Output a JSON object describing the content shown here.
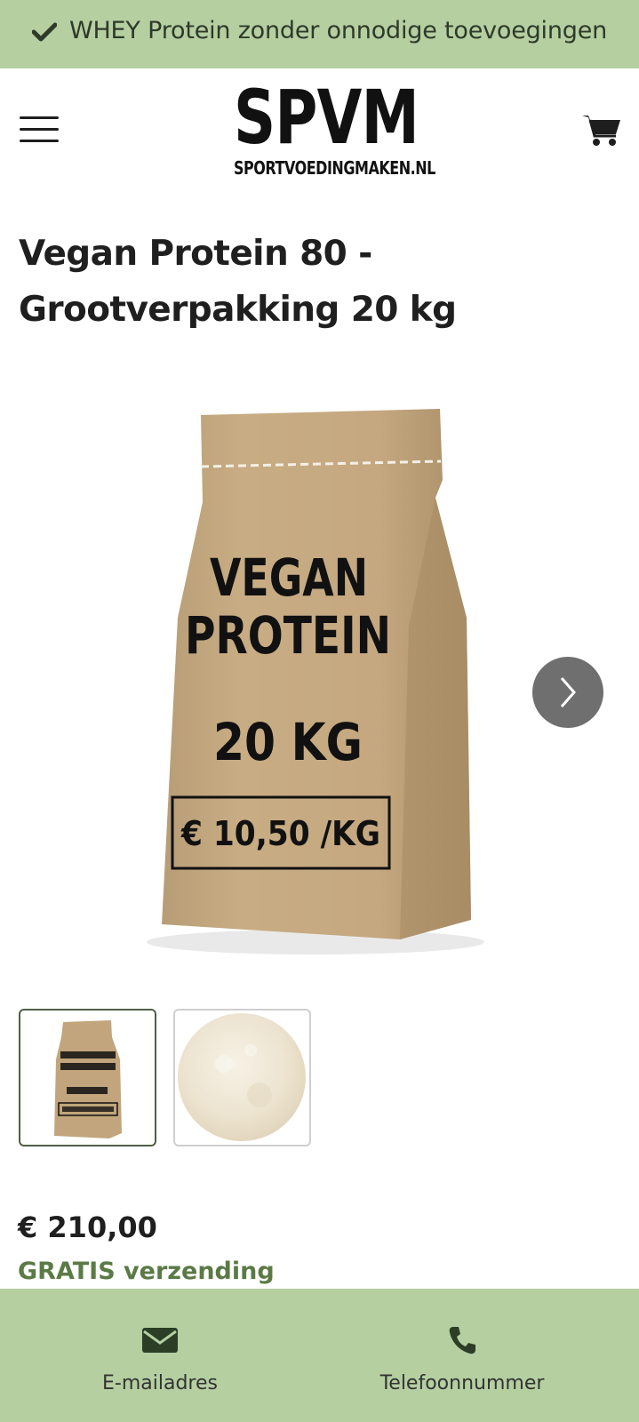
{
  "announcement": {
    "text": "WHEY Protein zonder onnodige toevoegingen"
  },
  "header": {
    "logo_main": "SPVM",
    "logo_sub": "SPORTVOEDINGMAKEN.NL"
  },
  "product": {
    "title_line1": "Vegan Protein 80 -",
    "title_line2": "Grootverpakking 20 kg",
    "bag_line1": "VEGAN",
    "bag_line2": "PROTEIN",
    "bag_weight": "20 KG",
    "bag_price": "€ 10,50 /KG",
    "price": "€ 210,00",
    "shipping": "GRATIS verzending"
  },
  "footer": {
    "email_label": "E-mailadres",
    "phone_label": "Telefoonnummer"
  },
  "colors": {
    "accent_green": "#b5cfa1",
    "text_green": "#5b7a46",
    "dark": "#1e1e1e"
  },
  "icons": [
    "check-icon",
    "menu-icon",
    "cart-icon",
    "chevron-right-icon",
    "envelope-icon",
    "phone-icon"
  ]
}
